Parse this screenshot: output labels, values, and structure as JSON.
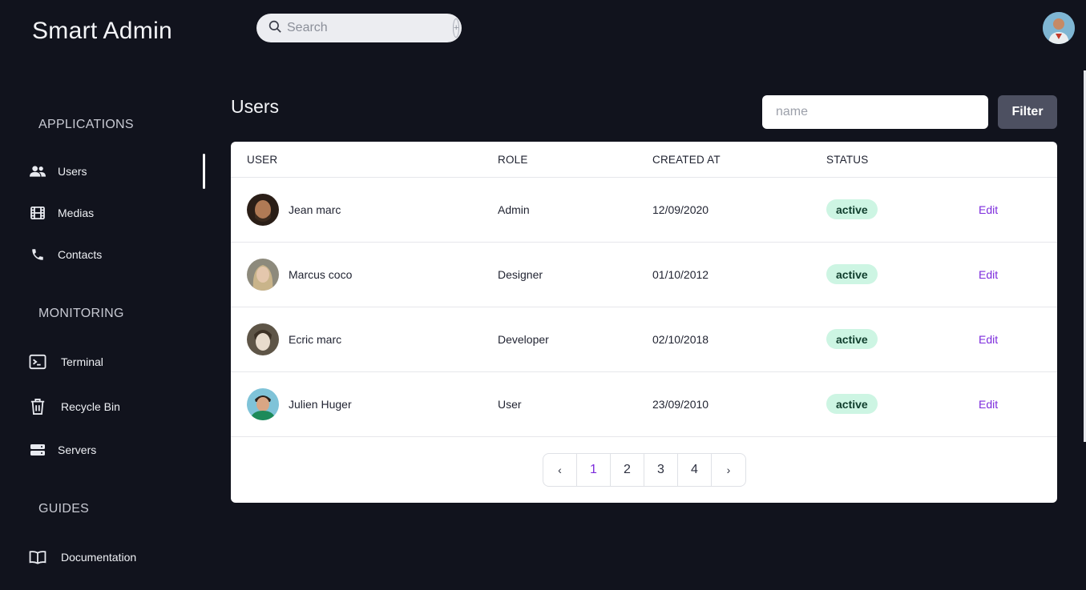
{
  "app": {
    "brand": "Smart Admin"
  },
  "search": {
    "placeholder": "Search",
    "shortcut": "+"
  },
  "sidebar": {
    "sections": [
      {
        "title": "APPLICATIONS",
        "items": [
          {
            "label": "Users",
            "icon": "users-icon",
            "active": true
          },
          {
            "label": "Medias",
            "icon": "film-icon"
          },
          {
            "label": "Contacts",
            "icon": "phone-icon"
          }
        ]
      },
      {
        "title": "MONITORING",
        "items": [
          {
            "label": "Terminal",
            "icon": "terminal-icon"
          },
          {
            "label": "Recycle Bin",
            "icon": "trash-icon"
          },
          {
            "label": "Servers",
            "icon": "server-icon"
          }
        ]
      },
      {
        "title": "GUIDES",
        "items": [
          {
            "label": "Documentation",
            "icon": "book-icon"
          }
        ]
      }
    ]
  },
  "main": {
    "title": "Users",
    "filter": {
      "placeholder": "name",
      "button_label": "Filter"
    },
    "table": {
      "headers": [
        "USER",
        "ROLE",
        "CREATED AT",
        "STATUS"
      ],
      "rows": [
        {
          "name": "Jean marc",
          "role": "Admin",
          "created_at": "12/09/2020",
          "status": "active",
          "action": "Edit"
        },
        {
          "name": "Marcus coco",
          "role": "Designer",
          "created_at": "01/10/2012",
          "status": "active",
          "action": "Edit"
        },
        {
          "name": "Ecric marc",
          "role": "Developer",
          "created_at": "02/10/2018",
          "status": "active",
          "action": "Edit"
        },
        {
          "name": "Julien Huger",
          "role": "User",
          "created_at": "23/09/2010",
          "status": "active",
          "action": "Edit"
        }
      ]
    },
    "pagination": {
      "prev": "‹",
      "pages": [
        "1",
        "2",
        "3",
        "4"
      ],
      "current": "1",
      "next": "›"
    }
  },
  "colors": {
    "background": "#11131d",
    "accent": "#7c2bdc",
    "badge_bg": "#cdf5e3",
    "filter_btn": "#4d5061"
  }
}
